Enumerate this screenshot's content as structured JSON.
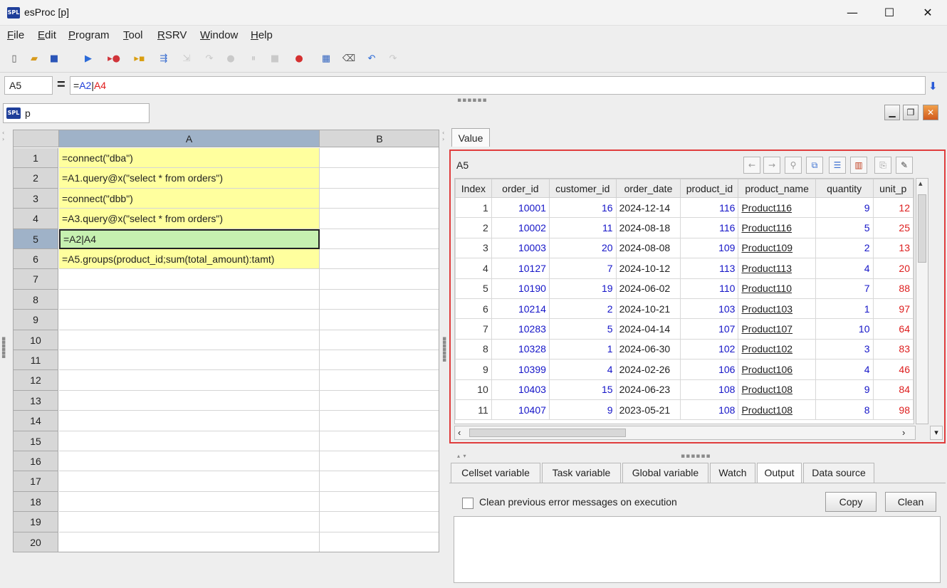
{
  "window": {
    "logo": "SPL",
    "title": "esProc  [p]",
    "minimize": "—",
    "maximize": "☐",
    "close": "✕"
  },
  "menu": [
    {
      "key": "F",
      "rest": "ile"
    },
    {
      "key": "E",
      "rest": "dit"
    },
    {
      "key": "P",
      "rest": "rogram"
    },
    {
      "key": "T",
      "rest": "ool"
    },
    {
      "key": "R",
      "rest": "SRV"
    },
    {
      "key": "W",
      "rest": "indow"
    },
    {
      "key": "H",
      "rest": "elp"
    }
  ],
  "toolbar_icons": [
    "new-file-icon",
    "open-folder-icon",
    "save-icon",
    "run-icon",
    "debug-icon",
    "step-icon",
    "run-to-cursor-icon",
    "step-into-icon",
    "step-over-icon",
    "stop-icon",
    "pause-icon",
    "breakpoint-icon",
    "calculator-icon",
    "eraser-icon",
    "undo-icon",
    "redo-icon"
  ],
  "formula": {
    "cell_name": "A5",
    "equals": "=",
    "prefix": "=",
    "ref1": "A2",
    "pipe": "|",
    "ref2": "A4",
    "arrow": "⬇"
  },
  "doc_tab": {
    "logo": "SPL",
    "name": "p"
  },
  "grid": {
    "columns": [
      "A",
      "B"
    ],
    "rows": [
      {
        "num": "1",
        "a": "=connect(\"dba\")"
      },
      {
        "num": "2",
        "a": "=A1.query@x(\"select * from orders\")"
      },
      {
        "num": "3",
        "a": "=connect(\"dbb\")"
      },
      {
        "num": "4",
        "a": "=A3.query@x(\"select * from orders\")"
      },
      {
        "num": "5",
        "a": "=A2|A4"
      },
      {
        "num": "6",
        "a": "=A5.groups(product_id;sum(total_amount):tamt)"
      },
      {
        "num": "7",
        "a": ""
      },
      {
        "num": "8",
        "a": ""
      },
      {
        "num": "9",
        "a": ""
      },
      {
        "num": "10",
        "a": ""
      },
      {
        "num": "11",
        "a": ""
      },
      {
        "num": "12",
        "a": ""
      },
      {
        "num": "13",
        "a": ""
      },
      {
        "num": "14",
        "a": ""
      },
      {
        "num": "15",
        "a": ""
      },
      {
        "num": "16",
        "a": ""
      },
      {
        "num": "17",
        "a": ""
      },
      {
        "num": "18",
        "a": ""
      },
      {
        "num": "19",
        "a": ""
      },
      {
        "num": "20",
        "a": ""
      }
    ],
    "selected_row": 5
  },
  "value_panel": {
    "tab": "Value",
    "cell_name": "A5",
    "columns": [
      "Index",
      "order_id",
      "customer_id",
      "order_date",
      "product_id",
      "product_name",
      "quantity",
      "unit_p"
    ],
    "rows": [
      [
        "1",
        "10001",
        "16",
        "2024-12-14",
        "116",
        "Product116",
        "9",
        "12"
      ],
      [
        "2",
        "10002",
        "11",
        "2024-08-18",
        "116",
        "Product116",
        "5",
        "25"
      ],
      [
        "3",
        "10003",
        "20",
        "2024-08-08",
        "109",
        "Product109",
        "2",
        "13"
      ],
      [
        "4",
        "10127",
        "7",
        "2024-10-12",
        "113",
        "Product113",
        "4",
        "20"
      ],
      [
        "5",
        "10190",
        "19",
        "2024-06-02",
        "110",
        "Product110",
        "7",
        "88"
      ],
      [
        "6",
        "10214",
        "2",
        "2024-10-21",
        "103",
        "Product103",
        "1",
        "97"
      ],
      [
        "7",
        "10283",
        "5",
        "2024-04-14",
        "107",
        "Product107",
        "10",
        "64"
      ],
      [
        "8",
        "10328",
        "1",
        "2024-06-30",
        "102",
        "Product102",
        "3",
        "83"
      ],
      [
        "9",
        "10399",
        "4",
        "2024-02-26",
        "106",
        "Product106",
        "4",
        "46"
      ],
      [
        "10",
        "10403",
        "15",
        "2024-06-23",
        "108",
        "Product108",
        "9",
        "84"
      ],
      [
        "11",
        "10407",
        "9",
        "2023-05-21",
        "108",
        "Product108",
        "8",
        "98"
      ]
    ]
  },
  "bottom_tabs": [
    "Cellset variable",
    "Task variable",
    "Global variable",
    "Watch",
    "Output",
    "Data source"
  ],
  "active_bottom_tab": "Output",
  "output": {
    "checkbox_label": "Clean previous error messages on execution",
    "copy": "Copy",
    "clean": "Clean"
  },
  "colors": {
    "selected_cell": "#c6f0b0",
    "formula_cell": "#ffff9e",
    "highlight_border": "#e03c3c",
    "accent_blue": "#1f3f9a"
  }
}
